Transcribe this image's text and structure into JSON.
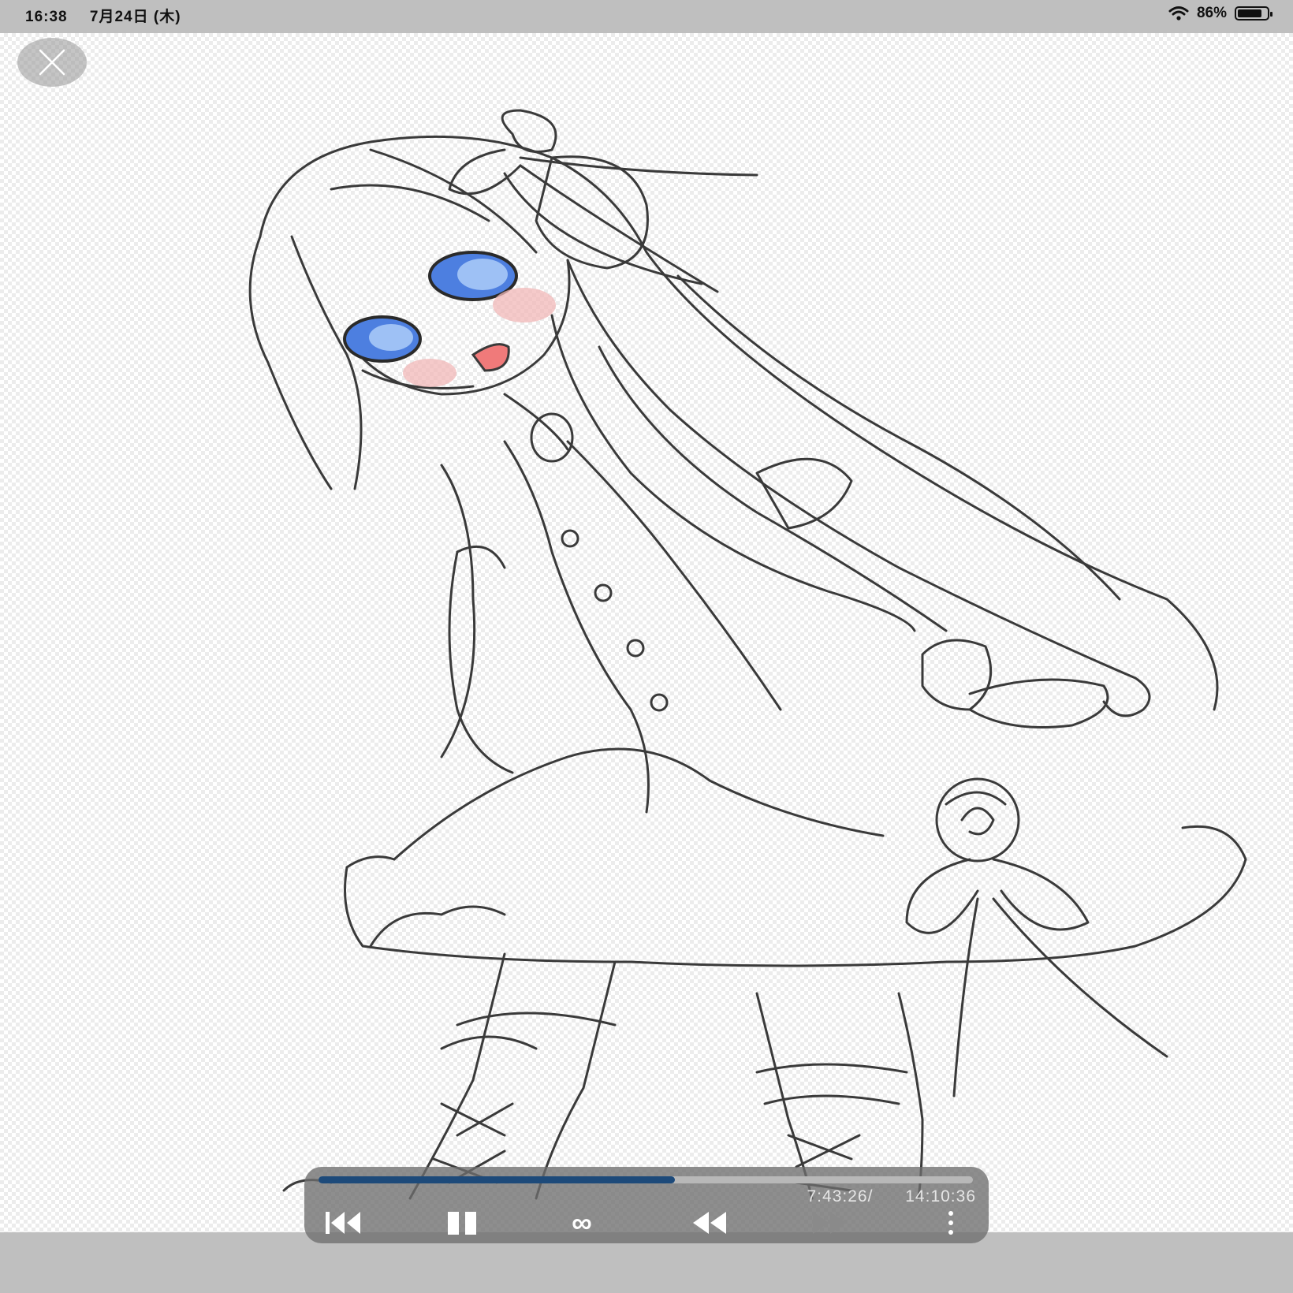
{
  "status_bar": {
    "time": "16:38",
    "date": "7月24日 (木)",
    "battery": "86%",
    "battery_level": 0.86
  },
  "viewer": {
    "close_icon": "close-icon",
    "artwork_description_icon": "line-art-illustration"
  },
  "player": {
    "progress_fraction": 0.544,
    "current_time": "7:43:26/",
    "total_time": "14:10:36",
    "controls": [
      {
        "name": "skip-to-start-icon"
      },
      {
        "name": "pause-icon"
      },
      {
        "name": "loop-icon",
        "glyph": "∞"
      },
      {
        "name": "rewind-icon"
      },
      {
        "name": "fast-forward-icon"
      },
      {
        "name": "more-options-icon"
      }
    ]
  },
  "colors": {
    "progress": "#1d4a7a",
    "eye_blue": "#4d7fe0",
    "blush": "#f2b8b8",
    "mouth": "#f07a7a"
  }
}
